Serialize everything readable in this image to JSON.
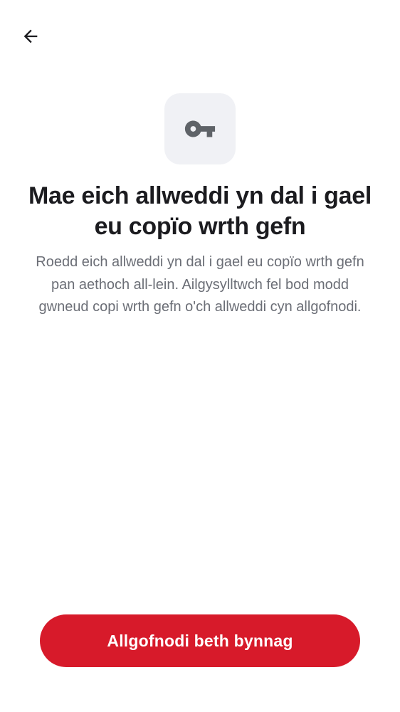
{
  "header": {
    "back_icon": "arrow-left-icon"
  },
  "hero": {
    "icon": "key-icon",
    "tile_color": "#f0f1f5",
    "icon_color": "#5f6368"
  },
  "content": {
    "title": "Mae eich allweddi yn dal i gael eu copïo wrth gefn",
    "body": "Roedd eich allweddi yn dal i gael eu copïo wrth gefn pan aethoch all-lein. Ailgysylltwch fel bod modd gwneud copi wrth gefn o'ch allweddi cyn allgofnodi."
  },
  "actions": {
    "primary_label": "Allgofnodi beth bynnag",
    "primary_color": "#d71a2a"
  }
}
